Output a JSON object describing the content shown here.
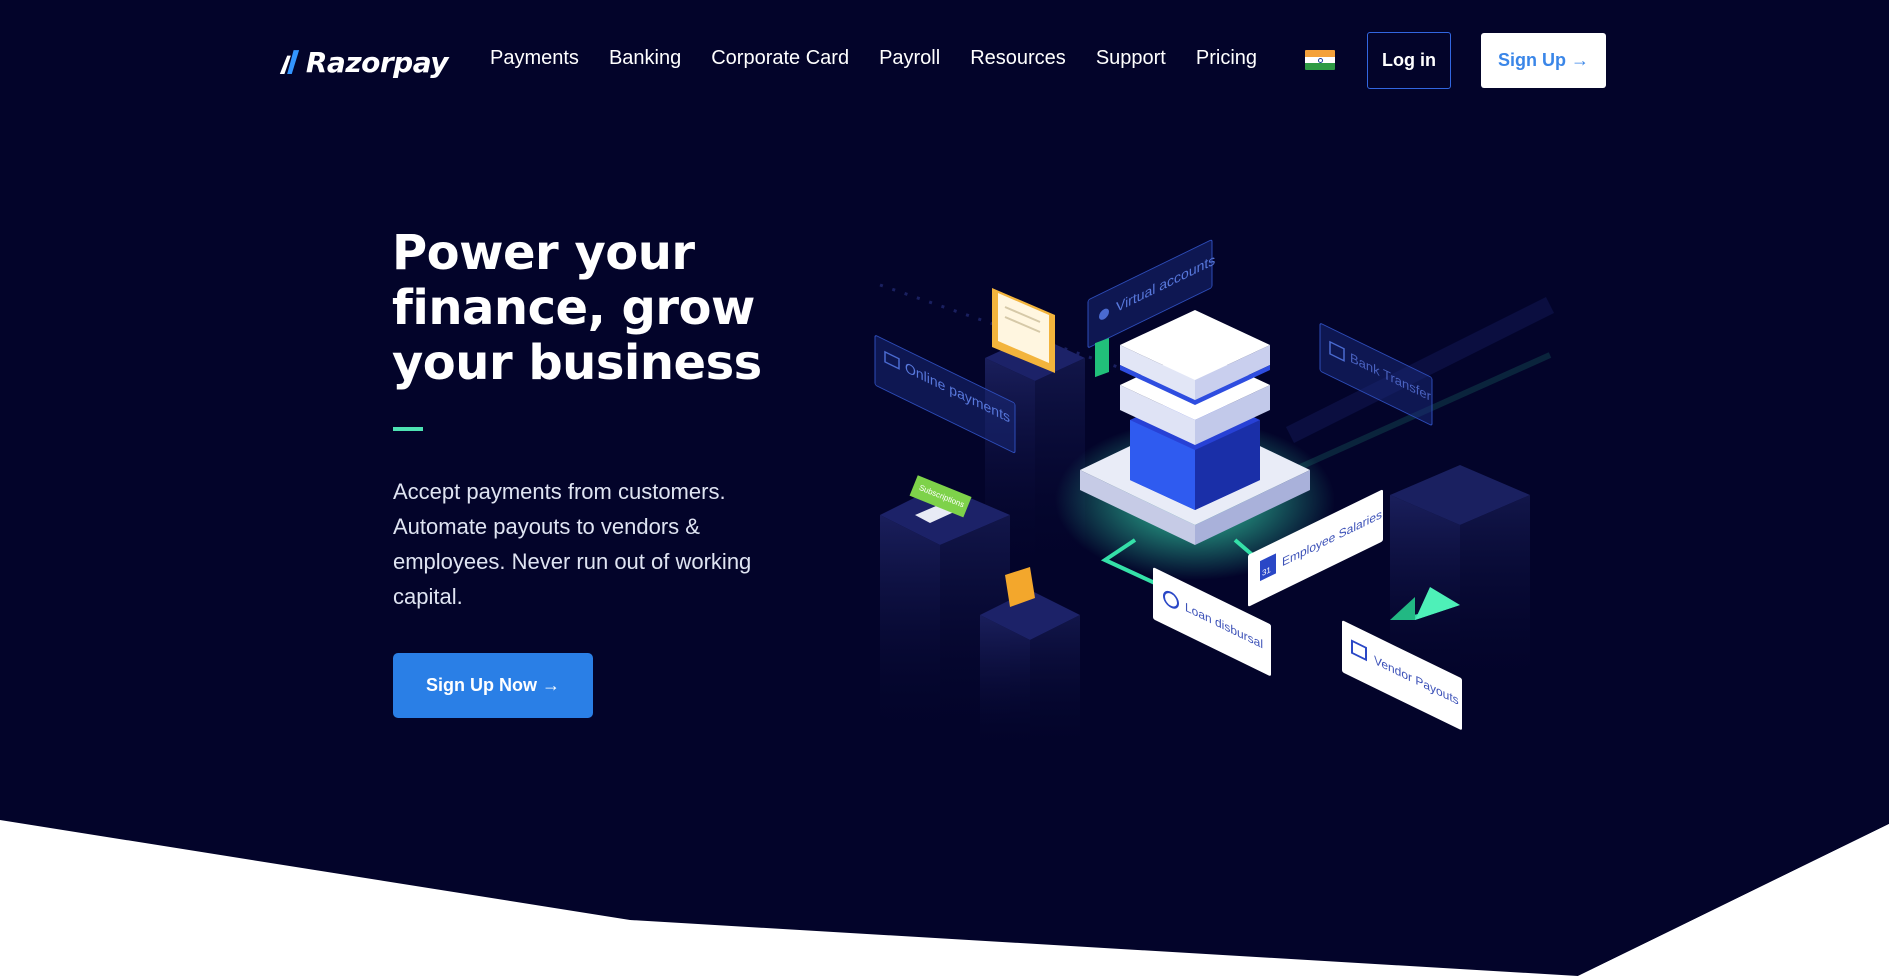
{
  "brand": {
    "name": "Razorpay"
  },
  "nav": {
    "items": [
      "Payments",
      "Banking",
      "Corporate Card",
      "Payroll",
      "Resources",
      "Support",
      "Pricing"
    ],
    "country_flag": "india-flag-icon",
    "login_label": "Log in",
    "signup_label": "Sign Up →"
  },
  "hero": {
    "headline": [
      "Power your",
      "finance, grow",
      "your business"
    ],
    "subtext": [
      "Accept payments from customers.",
      "Automate payouts to vendors &",
      "employees. Never run out of working",
      "capital."
    ],
    "cta_label": "Sign Up Now →"
  },
  "illustration": {
    "labels": {
      "virtual_accounts": "Virtual accounts",
      "online_payments": "Online payments",
      "bank_transfer": "Bank Transfer",
      "subscriptions": "Subscriptions",
      "employee_salaries": "Employee Salaries",
      "loan_disbursal": "Loan disbursal",
      "vendor_payouts": "Vendor Payouts",
      "calendar_day": "31"
    }
  },
  "colors": {
    "hero_background": "#03042a",
    "accent_green": "#4ee3b3",
    "primary_blue": "#2a7fe6",
    "signup_text_blue": "#3a86e8"
  }
}
